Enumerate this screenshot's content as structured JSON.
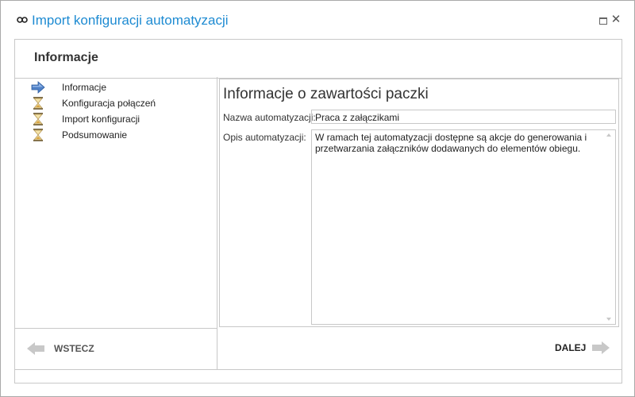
{
  "window": {
    "title": "Import konfiguracji automatyzacji",
    "icons": {
      "app": "link-icon",
      "maximize": "maximize-icon",
      "close": "close-icon"
    },
    "close_glyph": "✕"
  },
  "header": {
    "title": "Informacje"
  },
  "steps": [
    {
      "label": "Informacje",
      "icon": "arrow-right-icon",
      "state": "current"
    },
    {
      "label": "Konfiguracja połączeń",
      "icon": "hourglass-icon",
      "state": "pending"
    },
    {
      "label": "Import konfiguracji",
      "icon": "hourglass-icon",
      "state": "pending"
    },
    {
      "label": "Podsumowanie",
      "icon": "hourglass-icon",
      "state": "pending"
    }
  ],
  "content": {
    "title": "Informacje o zawartości paczki",
    "name_label": "Nazwa automatyzacji:",
    "name_value": "Praca z załączikami",
    "desc_label": "Opis automatyzacji:",
    "desc_value": "W ramach tej automatyzacji dostępne są akcje do generowania i przetwarzania załączników dodawanych do elementów obiegu."
  },
  "navigation": {
    "back_label": "WSTECZ",
    "next_label": "DALEJ",
    "back_enabled": false
  },
  "colors": {
    "accent": "#1e8bd2",
    "arrow_active": "#4f81c7",
    "arrow_disabled": "#c8c8c8",
    "border": "#c8c8c8"
  }
}
